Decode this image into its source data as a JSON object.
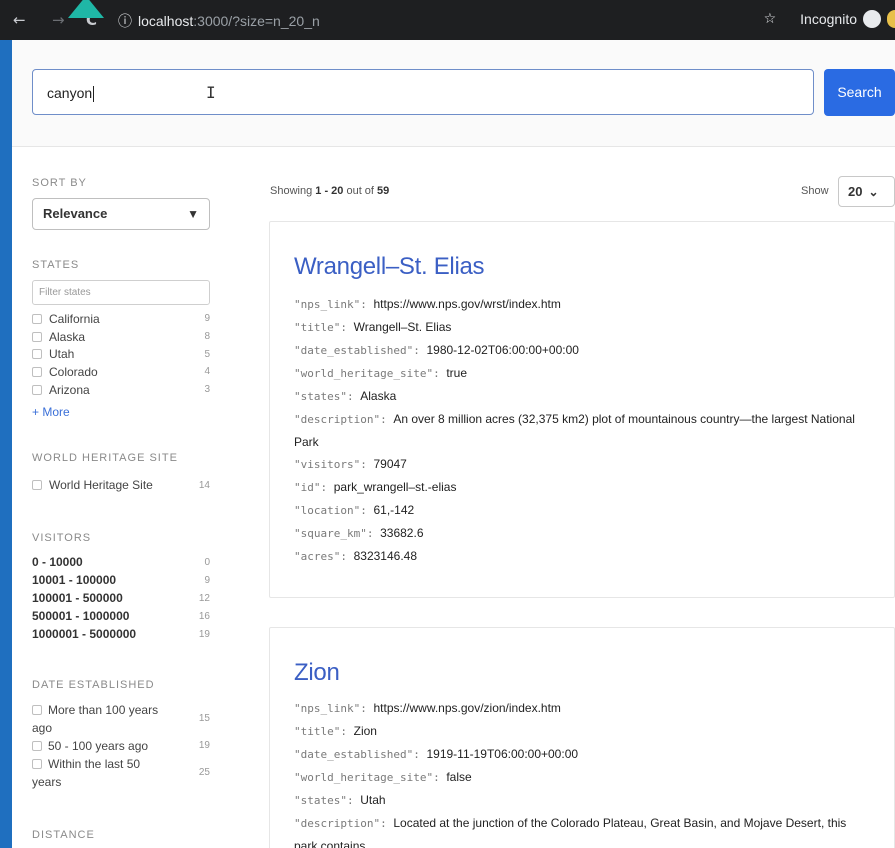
{
  "browser": {
    "back_icon": "←",
    "forward_icon": "→",
    "reload_icon": "C",
    "info_icon": "ⓘ",
    "url_host": "localhost",
    "url_rest": ":3000/?size=n_20_n",
    "star_icon": "☆",
    "incognito_label": "Incognito"
  },
  "search": {
    "value": "canyon",
    "button_label": "Search"
  },
  "sidebar": {
    "sort_title": "SORT BY",
    "sort_value": "Relevance",
    "states_title": "STATES",
    "states_filter_placeholder": "Filter states",
    "states": [
      {
        "label": "California",
        "count": "9"
      },
      {
        "label": "Alaska",
        "count": "8"
      },
      {
        "label": "Utah",
        "count": "5"
      },
      {
        "label": "Colorado",
        "count": "4"
      },
      {
        "label": "Arizona",
        "count": "3"
      }
    ],
    "more_label": "+ More",
    "whs_title": "WORLD HERITAGE SITE",
    "whs_option": {
      "label": "World Heritage Site",
      "count": "14"
    },
    "visitors_title": "VISITORS",
    "visitors": [
      {
        "label": "0 - 10000",
        "count": "0"
      },
      {
        "label": "10001 - 100000",
        "count": "9"
      },
      {
        "label": "100001 - 500000",
        "count": "12"
      },
      {
        "label": "500001 - 1000000",
        "count": "16"
      },
      {
        "label": "1000001 - 5000000",
        "count": "19"
      }
    ],
    "date_title": "DATE ESTABLISHED",
    "dates": [
      {
        "label": "More than 100 years ago",
        "count": "15"
      },
      {
        "label": "50 - 100 years ago",
        "count": "19"
      },
      {
        "label": "Within the last 50 years",
        "count": "25"
      }
    ],
    "distance_title": "DISTANCE"
  },
  "results": {
    "showing_prefix": "Showing ",
    "range": "1 - 20",
    "out_of": " out of ",
    "total": "59",
    "show_label": "Show",
    "page_size": "20"
  },
  "cards": [
    {
      "title": "Wrangell–St. Elias",
      "fields": [
        {
          "key": "\"nps_link\"",
          "value": "https://www.nps.gov/wrst/index.htm"
        },
        {
          "key": "\"title\"",
          "value": "Wrangell–St. Elias"
        },
        {
          "key": "\"date_established\"",
          "value": "1980-12-02T06:00:00+00:00"
        },
        {
          "key": "\"world_heritage_site\"",
          "value": "true"
        },
        {
          "key": "\"states\"",
          "value": "Alaska"
        },
        {
          "key": "\"description\"",
          "value": "An over 8 million acres (32,375 km2) plot of mountainous country—the largest National Park"
        },
        {
          "key": "\"visitors\"",
          "value": "79047"
        },
        {
          "key": "\"id\"",
          "value": "park_wrangell–st.-elias"
        },
        {
          "key": "\"location\"",
          "value": "61,-142"
        },
        {
          "key": "\"square_km\"",
          "value": "33682.6"
        },
        {
          "key": "\"acres\"",
          "value": "8323146.48"
        }
      ]
    },
    {
      "title": "Zion",
      "fields": [
        {
          "key": "\"nps_link\"",
          "value": "https://www.nps.gov/zion/index.htm"
        },
        {
          "key": "\"title\"",
          "value": "Zion"
        },
        {
          "key": "\"date_established\"",
          "value": "1919-11-19T06:00:00+00:00"
        },
        {
          "key": "\"world_heritage_site\"",
          "value": "false"
        },
        {
          "key": "\"states\"",
          "value": "Utah"
        },
        {
          "key": "\"description\"",
          "value": "Located at the junction of the Colorado Plateau, Great Basin, and Mojave Desert, this park contains"
        }
      ]
    }
  ]
}
